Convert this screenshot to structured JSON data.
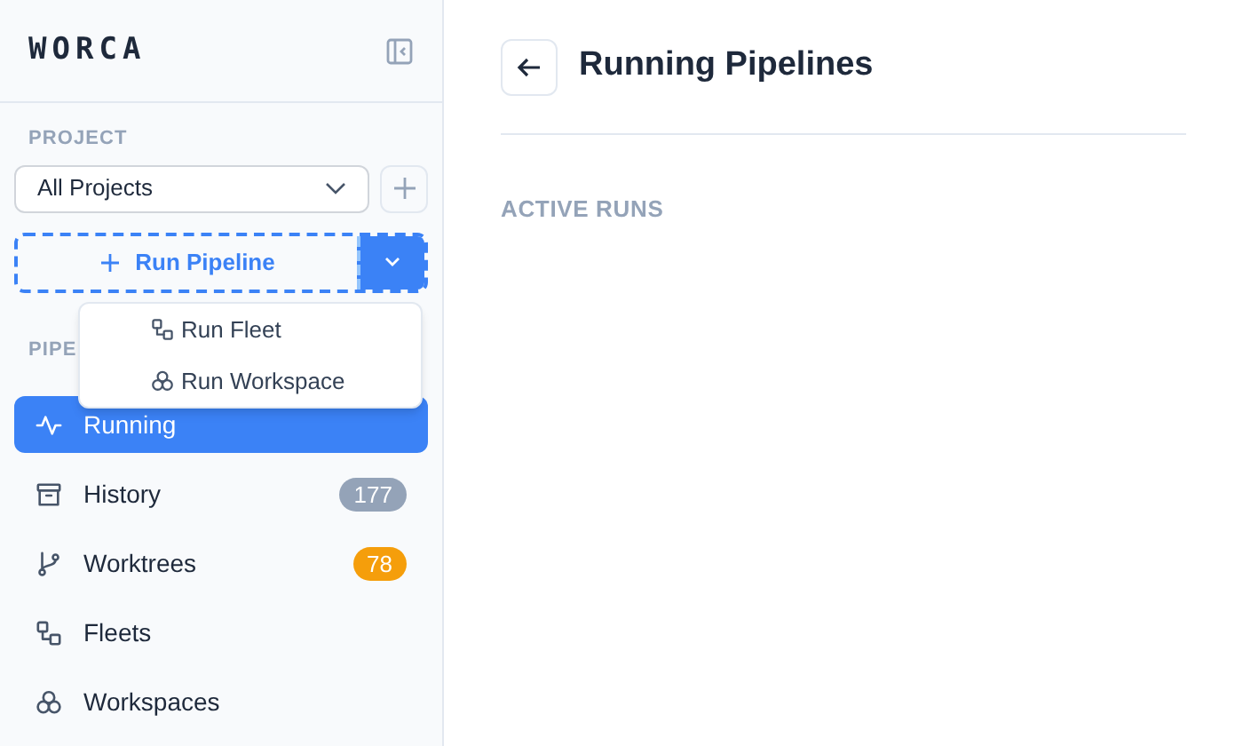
{
  "sidebar": {
    "logo": "WORCA",
    "project": {
      "label": "PROJECT",
      "value": "All Projects"
    },
    "run_button": {
      "label": "Run Pipeline"
    },
    "run_menu": [
      {
        "label": "Run Fleet"
      },
      {
        "label": "Run Workspace"
      }
    ],
    "section_label": "PIPE",
    "items": [
      {
        "label": "Running",
        "selected": true
      },
      {
        "label": "History",
        "selected": false,
        "badge": "177",
        "color": "#94a3b8"
      },
      {
        "label": "Worktrees",
        "selected": false,
        "badge": "78",
        "color": "#f59e0b"
      },
      {
        "label": "Fleets",
        "selected": false
      },
      {
        "label": "Workspaces",
        "selected": false
      }
    ]
  },
  "main": {
    "title": "Running Pipelines",
    "section": "ACTIVE RUNS"
  }
}
